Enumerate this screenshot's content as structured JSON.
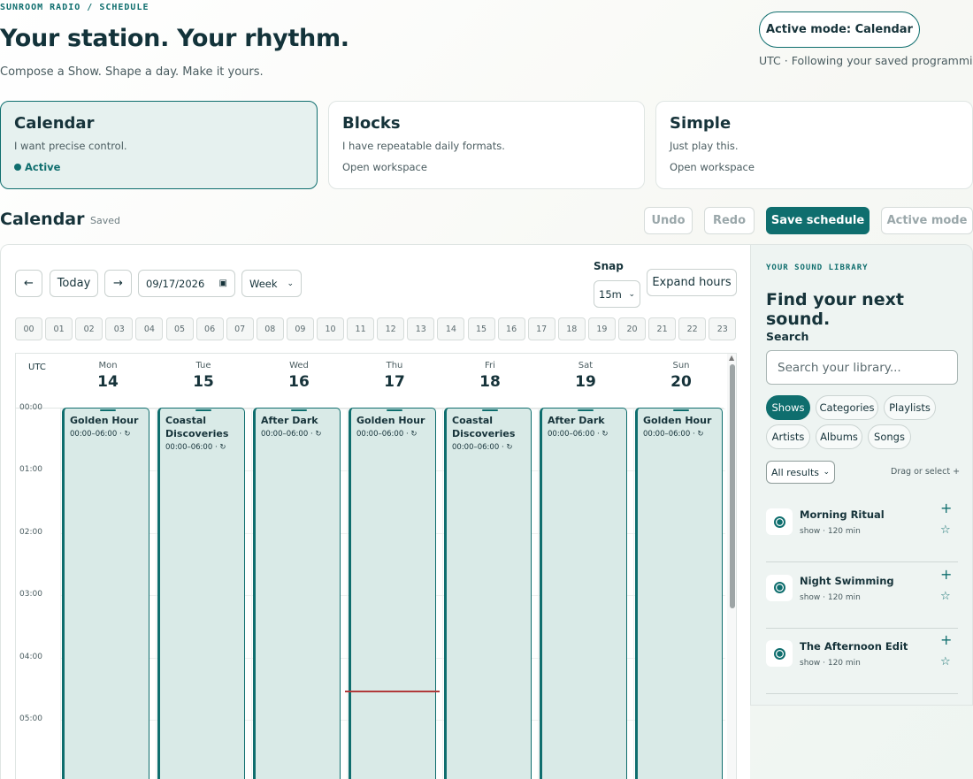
{
  "header": {
    "breadcrumb": "SUNROOM RADIO / SCHEDULE",
    "title": "Your station. Your rhythm.",
    "subtitle": "Compose a Show. Shape a day. Make it yours.",
    "mode_pill": "Active mode: Calendar",
    "tz_line": "UTC · Following your saved programming"
  },
  "modes": [
    {
      "title": "Calendar",
      "desc": "I want precise control.",
      "status": "Active"
    },
    {
      "title": "Blocks",
      "desc": "I have repeatable daily formats.",
      "status": "Open workspace"
    },
    {
      "title": "Simple",
      "desc": "Just play this.",
      "status": "Open workspace"
    }
  ],
  "section": {
    "title": "Calendar",
    "saved": "Saved",
    "undo": "Undo",
    "redo": "Redo",
    "save": "Save schedule",
    "active_mode": "Active mode"
  },
  "toolbar": {
    "prev": "←",
    "today": "Today",
    "next": "→",
    "date": "09/17/2026",
    "view": "Week",
    "snap_label": "Snap",
    "snap": "15m",
    "expand": "Expand hours"
  },
  "hours": [
    "00",
    "01",
    "02",
    "03",
    "04",
    "05",
    "06",
    "07",
    "08",
    "09",
    "10",
    "11",
    "12",
    "13",
    "14",
    "15",
    "16",
    "17",
    "18",
    "19",
    "20",
    "21",
    "22",
    "23"
  ],
  "grid": {
    "tz": "UTC",
    "days": [
      {
        "name": "Mon",
        "date": "14"
      },
      {
        "name": "Tue",
        "date": "15"
      },
      {
        "name": "Wed",
        "date": "16"
      },
      {
        "name": "Thu",
        "date": "17"
      },
      {
        "name": "Fri",
        "date": "18"
      },
      {
        "name": "Sat",
        "date": "19"
      },
      {
        "name": "Sun",
        "date": "20"
      }
    ],
    "times": [
      "00:00",
      "01:00",
      "02:00",
      "03:00",
      "04:00",
      "05:00"
    ],
    "events": [
      {
        "title": "Golden Hour",
        "time": "00:00–06:00 · ↻"
      },
      {
        "title": "Coastal Discoveries",
        "time": "00:00–06:00 · ↻"
      },
      {
        "title": "After Dark",
        "time": "00:00–06:00 · ↻"
      },
      {
        "title": "Golden Hour",
        "time": "00:00–06:00 · ↻"
      },
      {
        "title": "Coastal Discoveries",
        "time": "00:00–06:00 · ↻"
      },
      {
        "title": "After Dark",
        "time": "00:00–06:00 · ↻"
      },
      {
        "title": "Golden Hour",
        "time": "00:00–06:00 · ↻"
      }
    ]
  },
  "library": {
    "eyebrow": "YOUR SOUND LIBRARY",
    "title": "Find your next sound.",
    "search_label": "Search",
    "search_placeholder": "Search your library...",
    "chips": [
      "Shows",
      "Categories",
      "Playlists",
      "Artists",
      "Albums",
      "Songs"
    ],
    "filter": "All results",
    "hint": "Drag or select +",
    "items": [
      {
        "title": "Morning Ritual",
        "meta": "show · 120 min"
      },
      {
        "title": "Night Swimming",
        "meta": "show · 120 min"
      },
      {
        "title": "The Afternoon Edit",
        "meta": "show · 120 min"
      }
    ]
  },
  "colors": {
    "accent": "#0f6e6e",
    "event_fill": "#d9eae7",
    "now_line": "#b03a3a"
  }
}
